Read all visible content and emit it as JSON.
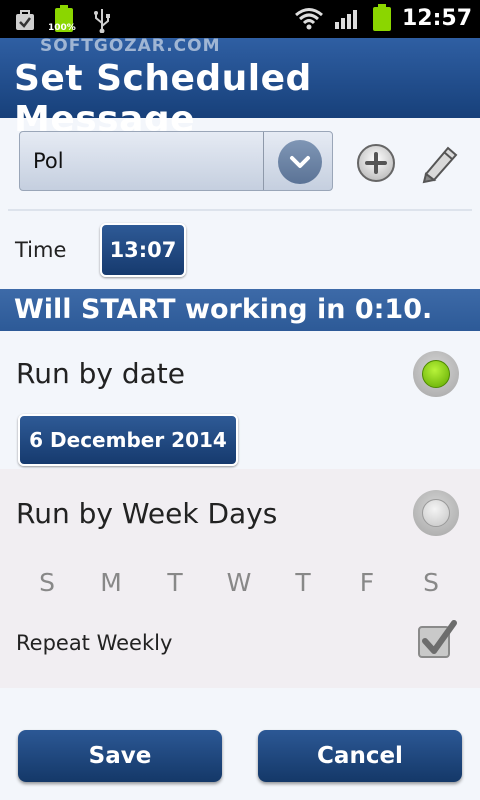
{
  "status_bar": {
    "battery_left_label": "100%",
    "time": "12:57",
    "icons": [
      "bag-icon",
      "battery-icon",
      "usb-icon",
      "wifi-icon",
      "signal-icon",
      "battery-icon"
    ]
  },
  "watermark": "SOFTGOZAR.COM",
  "title": "Set Scheduled Message",
  "contact": {
    "selected": "Pol",
    "dropdown_icon": "chevron-down-icon",
    "add_icon": "add-icon",
    "edit_icon": "pencil-icon"
  },
  "time": {
    "label": "Time",
    "value": "13:07"
  },
  "banner": "Will START working in 0:10.",
  "run_by_date": {
    "label": "Run by date",
    "selected": true,
    "date": "6 December 2014"
  },
  "run_by_week": {
    "label": "Run by Week Days",
    "selected": false,
    "days": [
      "S",
      "M",
      "T",
      "W",
      "T",
      "F",
      "S"
    ],
    "repeat_label": "Repeat Weekly",
    "repeat_checked": true
  },
  "buttons": {
    "save": "Save",
    "cancel": "Cancel"
  },
  "colors": {
    "accent": "#1e4a85",
    "radio_active": "#7fd11b"
  }
}
